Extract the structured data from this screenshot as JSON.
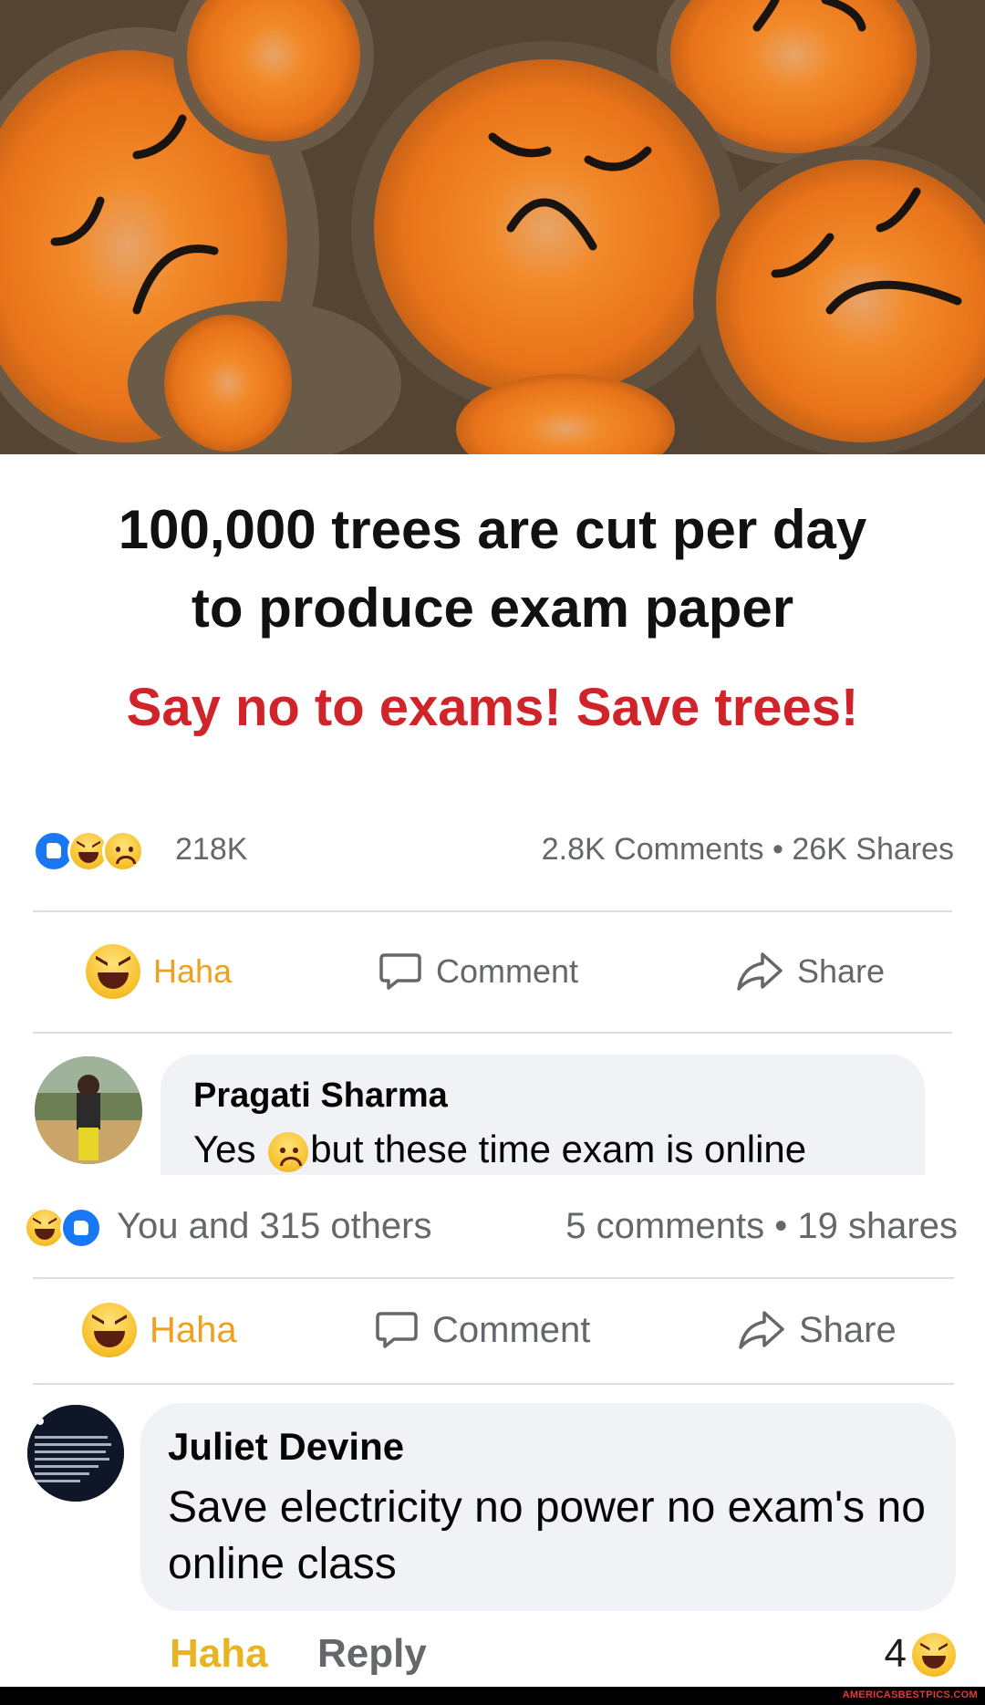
{
  "post": {
    "headline_line1": "100,000 trees are cut per day",
    "headline_line2": "to produce exam paper",
    "slogan": "Say no to exams! Save trees!",
    "reaction_icons": [
      "like-icon",
      "haha-icon",
      "sad-icon"
    ],
    "reaction_count": "218K",
    "comments_shares": "2.8K Comments • 26K Shares",
    "actions": {
      "haha": "Haha",
      "comment": "Comment",
      "share": "Share"
    }
  },
  "comment1": {
    "author": "Pragati Sharma",
    "text_before": "Yes",
    "text_after": "but these time exam is online",
    "reaction_icons": [
      "haha-icon",
      "like-icon"
    ],
    "reactors": "You and 315 others",
    "comments_shares": "5 comments • 19 shares",
    "actions": {
      "haha": "Haha",
      "comment": "Comment",
      "share": "Share"
    }
  },
  "comment2": {
    "author": "Juliet Devine",
    "text": "Save electricity no power no exam's no online class",
    "actions": {
      "haha": "Haha",
      "reply": "Reply"
    },
    "reaction_count": "4",
    "reaction_icon": "haha-icon"
  },
  "watermark": "AMERICASBESTPICS.COM",
  "colors": {
    "slogan": "#d0242b",
    "haha_label": "#f0a020",
    "muted_text": "#65676b",
    "bubble_bg": "#f0f2f5",
    "like_blue": "#1877f2"
  }
}
